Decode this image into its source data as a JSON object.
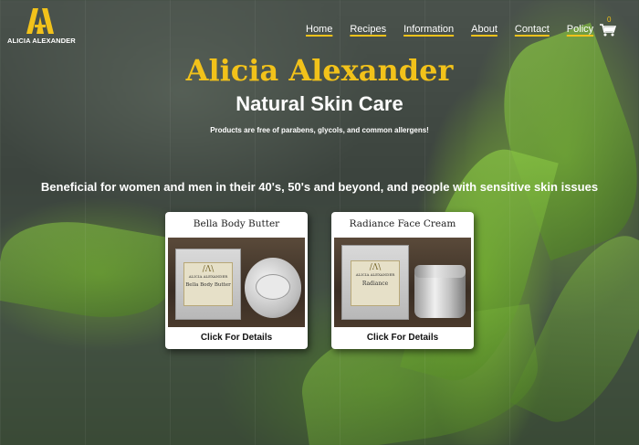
{
  "site": {
    "logo_text": "ALICIA ALEXANDER",
    "brand_title": "Alicia Alexander",
    "subtitle": "Natural Skin Care",
    "tagline": "Products are free of parabens, glycols, and common allergens!",
    "benefit": "Beneficial for women and men in their 40's, 50's and beyond, and people with sensitive skin issues"
  },
  "nav": {
    "items": [
      {
        "label": "Home"
      },
      {
        "label": "Recipes"
      },
      {
        "label": "Information"
      },
      {
        "label": "About"
      },
      {
        "label": "Contact"
      },
      {
        "label": "Policy"
      }
    ]
  },
  "cart": {
    "count": "0",
    "icon": "cart-icon"
  },
  "products": [
    {
      "title": "Bella Body Butter",
      "link_label": "Click For Details",
      "box_brand": "ALICIA ALEXANDER",
      "box_name": "Bella Body Butter"
    },
    {
      "title": "Radiance Face Cream",
      "link_label": "Click For Details",
      "box_brand": "ALICIA ALEXANDER",
      "box_name": "Radiance"
    }
  ],
  "colors": {
    "accent": "#f2c21a",
    "text_light": "#ffffff",
    "card_bg": "#ffffff"
  }
}
